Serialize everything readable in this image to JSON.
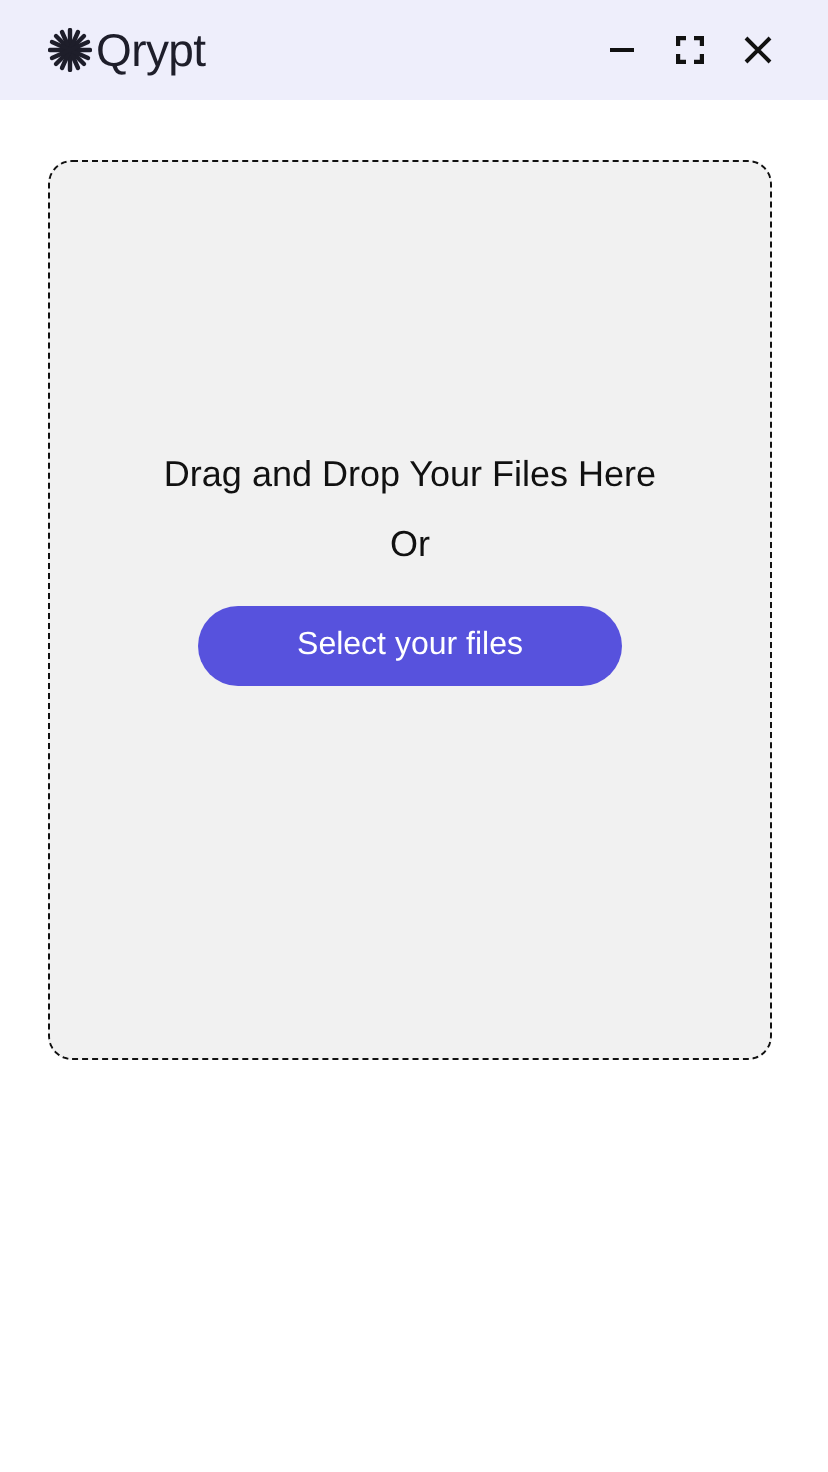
{
  "app": {
    "name": "Qrypt"
  },
  "dropzone": {
    "title": "Drag and Drop Your Files Here",
    "separator": "Or",
    "button": "Select your files"
  }
}
